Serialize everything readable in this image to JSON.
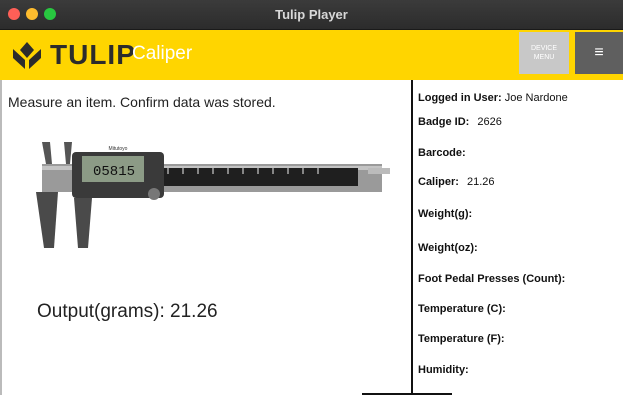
{
  "window": {
    "title": "Tulip Player"
  },
  "header": {
    "logo_text": "TULIP",
    "app_name": "Caliper",
    "device_menu_line1": "DEVICE",
    "device_menu_line2": "MENU",
    "menu_icon": "hamburger-icon"
  },
  "main": {
    "instruction": "Measure an item. Confirm data was stored.",
    "caliper_display": "05815",
    "caliper_brand": "Mitutoyo",
    "output_label": "Output(grams):",
    "output_value": "21.26"
  },
  "fields": {
    "user_label": "Logged in User:",
    "user_value": "Joe Nardone",
    "badge_label": "Badge ID:",
    "badge_value": "2626",
    "barcode_label": "Barcode:",
    "caliper_label": "Caliper:",
    "caliper_value": "21.26",
    "weight_g_label": "Weight(g):",
    "weight_oz_label": "Weight(oz):",
    "pedal_label": "Foot Pedal Presses (Count):",
    "temp_c_label": "Temperature (C):",
    "temp_f_label": "Temperature (F):",
    "humidity_label": "Humidity:"
  },
  "colors": {
    "brand_yellow": "#ffd500",
    "menu_gray": "#5f5f5f"
  }
}
